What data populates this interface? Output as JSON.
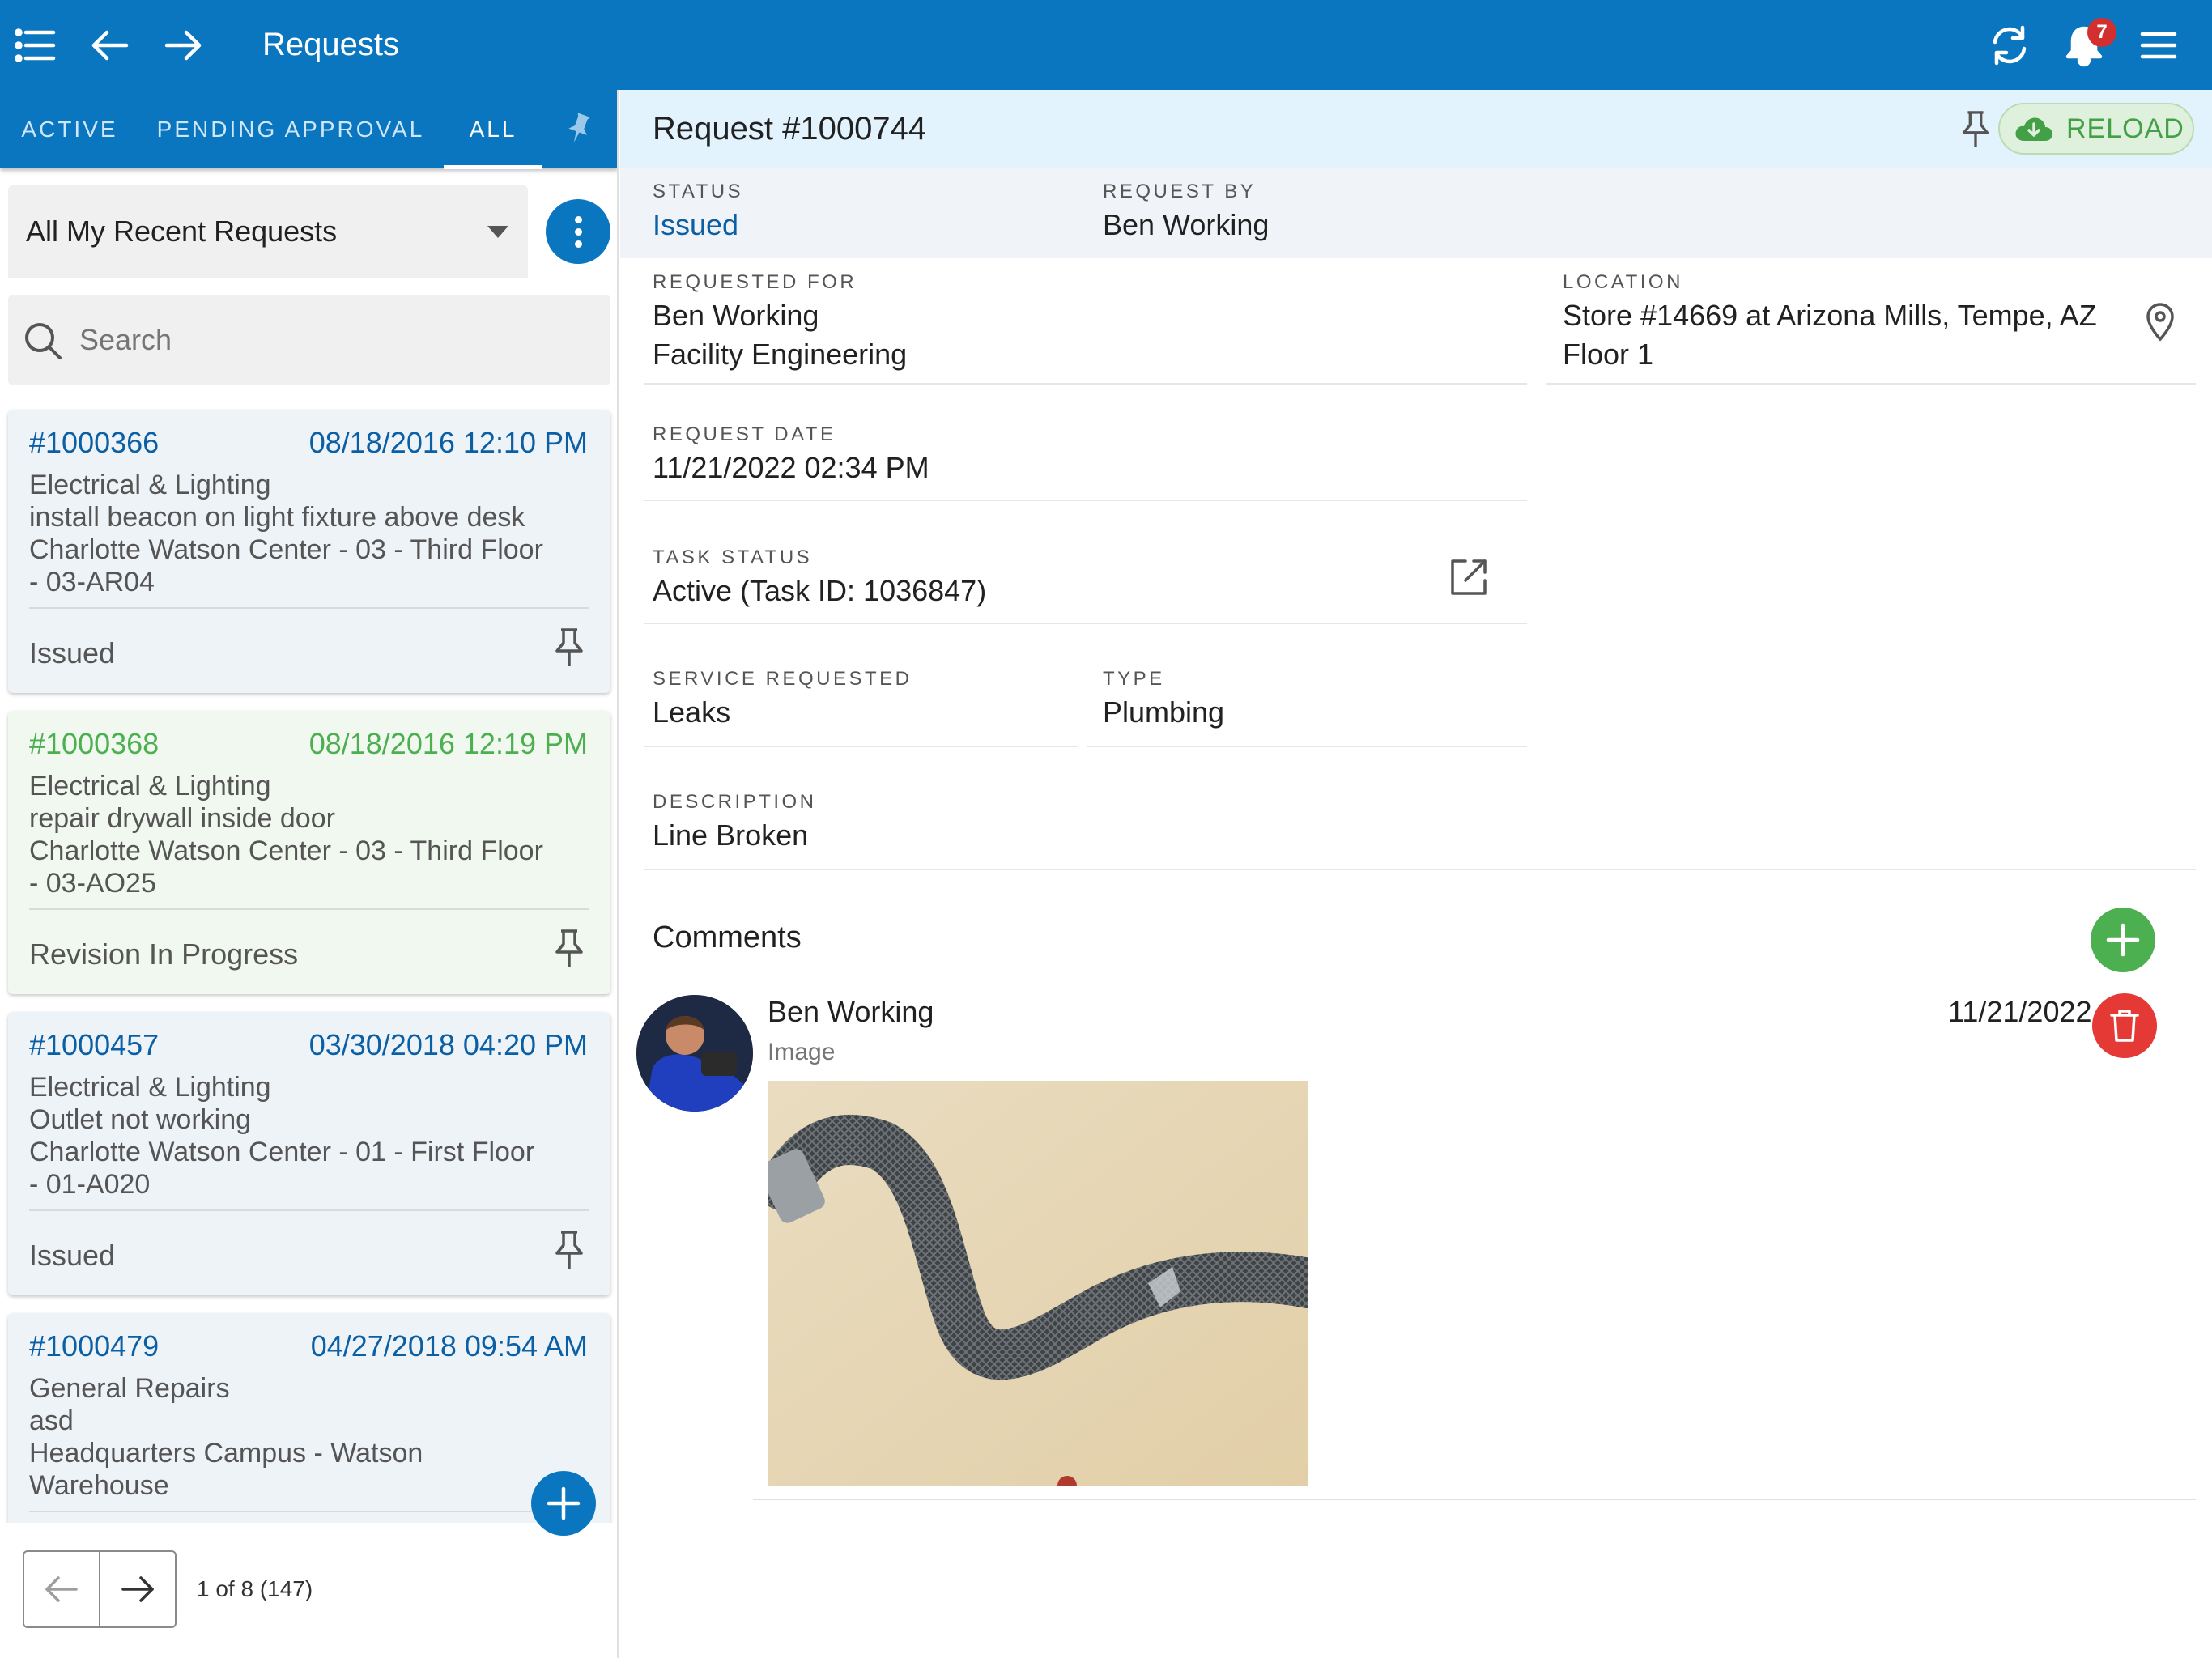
{
  "app": {
    "title": "Requests",
    "notification_count": "7",
    "accent_color": "#0b76c0",
    "icons": [
      "list-icon",
      "arrow-left-icon",
      "arrow-right-icon",
      "refresh-icon",
      "bell-icon",
      "hamburger-menu-icon"
    ]
  },
  "tabs": [
    {
      "label": "ACTIVE",
      "selected": false
    },
    {
      "label": "PENDING APPROVAL",
      "selected": false
    },
    {
      "label": "ALL",
      "selected": true
    }
  ],
  "filter": {
    "selected": "All My Recent Requests"
  },
  "search": {
    "placeholder": "Search"
  },
  "cards": [
    {
      "number": "#1000366",
      "date": "08/18/2016 12:10 PM",
      "category": "Electrical & Lighting",
      "summary": "install beacon on light fixture above desk",
      "location": "Charlotte Watson Center - 03 - Third Floor",
      "location2": "- 03-AR04",
      "status": "Issued"
    },
    {
      "number": "#1000368",
      "date": "08/18/2016 12:19 PM",
      "category": "Electrical & Lighting",
      "summary": "repair drywall inside door",
      "location": "Charlotte Watson Center - 03 - Third Floor",
      "location2": "- 03-AO25",
      "status": "Revision In Progress"
    },
    {
      "number": "#1000457",
      "date": "03/30/2018 04:20 PM",
      "category": "Electrical & Lighting",
      "summary": "Outlet not working",
      "location": "Charlotte Watson Center - 01 - First Floor",
      "location2": "- 01-A020",
      "status": "Issued"
    },
    {
      "number": "#1000479",
      "date": "04/27/2018 09:54 AM",
      "category": "General Repairs",
      "summary": "asd",
      "location": "Headquarters Campus - Watson",
      "location2": "Warehouse",
      "status": ""
    }
  ],
  "pager": {
    "text": "1 of 8 (147)"
  },
  "detail": {
    "title": "Request #1000744",
    "reload_label": "RELOAD",
    "status_label": "STATUS",
    "status_value": "Issued",
    "request_by_label": "REQUEST BY",
    "request_by_value": "Ben Working",
    "requested_for_label": "REQUESTED FOR",
    "requested_for_name": "Ben Working",
    "requested_for_dept": "Facility Engineering",
    "location_label": "LOCATION",
    "location_line1": "Store #14669 at Arizona Mills, Tempe, AZ",
    "location_line2": "Floor 1",
    "request_date_label": "REQUEST DATE",
    "request_date_value": "11/21/2022 02:34 PM",
    "task_status_label": "TASK STATUS",
    "task_status_value": "Active (Task ID: 1036847)",
    "service_label": "SERVICE REQUESTED",
    "service_value": "Leaks",
    "type_label": "TYPE",
    "type_value": "Plumbing",
    "description_label": "DESCRIPTION",
    "description_value": "Line Broken"
  },
  "comments": {
    "title": "Comments",
    "items": [
      {
        "author": "Ben Working",
        "type": "Image",
        "date": "11/21/2022"
      }
    ]
  }
}
